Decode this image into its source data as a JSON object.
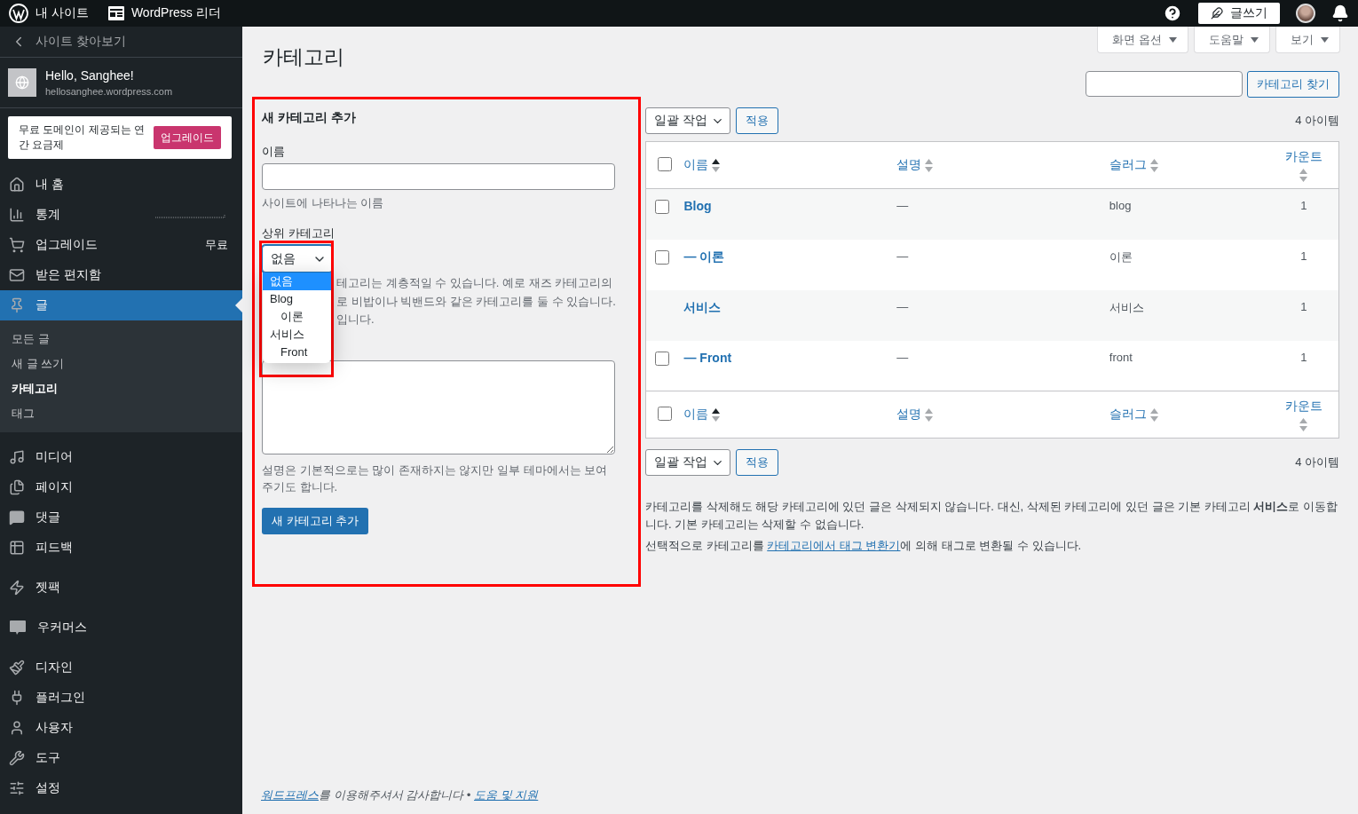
{
  "topbar": {
    "site_label": "내 사이트",
    "reader_label": "WordPress 리더",
    "write_button": "글쓰기"
  },
  "sidebar": {
    "back_link": "사이트 찾아보기",
    "site": {
      "title": "Hello, Sanghee!",
      "url": "hellosanghee.wordpress.com"
    },
    "promo": {
      "text": "무료 도메인이 제공되는 연간 요금제",
      "button": "업그레이드"
    },
    "groups": [
      {
        "items": [
          {
            "kind": "link",
            "label": "내 홈",
            "selected": false
          },
          {
            "kind": "stats",
            "label": "통계",
            "selected": false
          },
          {
            "kind": "link",
            "label": "업그레이드",
            "badge": "무료",
            "selected": false
          },
          {
            "kind": "link",
            "label": "받은 편지함",
            "selected": false
          },
          {
            "kind": "link",
            "label": "글",
            "selected": true,
            "children": [
              {
                "label": "모든 글",
                "selected": false
              },
              {
                "label": "새 글 쓰기",
                "selected": false
              },
              {
                "label": "카테고리",
                "selected": true
              },
              {
                "label": "태그",
                "selected": false
              }
            ]
          }
        ]
      },
      {
        "items": [
          {
            "kind": "link",
            "label": "미디어",
            "selected": false
          },
          {
            "kind": "link",
            "label": "페이지",
            "selected": false
          },
          {
            "kind": "link",
            "label": "댓글",
            "selected": false
          },
          {
            "kind": "link",
            "label": "피드백",
            "selected": false
          }
        ]
      },
      {
        "items": [
          {
            "kind": "link",
            "label": "젯팩",
            "selected": false
          }
        ]
      },
      {
        "items": [
          {
            "kind": "link",
            "label": "우커머스",
            "selected": false
          }
        ]
      },
      {
        "items": [
          {
            "kind": "link",
            "label": "디자인",
            "selected": false
          },
          {
            "kind": "link",
            "label": "플러그인",
            "selected": false
          },
          {
            "kind": "link",
            "label": "사용자",
            "selected": false
          },
          {
            "kind": "link",
            "label": "도구",
            "selected": false
          },
          {
            "kind": "link",
            "label": "설정",
            "selected": false
          }
        ]
      }
    ]
  },
  "page": {
    "title": "카테고리",
    "screen_buttons": [
      "화면 옵션",
      "도움말",
      "보기"
    ],
    "search_button": "카테고리 찾기"
  },
  "form": {
    "highlighted": true,
    "heading": "새 카테고리 추가",
    "name_label": "이름",
    "name_hint": "사이트에 나타나는 이름",
    "parent_label": "상위 카테고리",
    "parent_select": {
      "value": "없음",
      "highlighted": true,
      "expanded": true,
      "options": [
        {
          "label": "없음",
          "selected": true
        },
        {
          "label": "Blog",
          "selected": false,
          "children": [
            {
              "label": "이론",
              "selected": false
            }
          ]
        },
        {
          "label": "서비스",
          "selected": false,
          "children": [
            {
              "label": "Front",
              "selected": false
            }
          ]
        }
      ]
    },
    "parent_hint_lines": [
      "테고리는 계층적일 수 있습니다. 예로 재즈 카테고리의",
      "로 비밥이나 빅밴드와 같은 카테고리를 둘 수 있습니다.",
      "입니다."
    ],
    "description_hint": "설명은 기본적으로는 많이 존재하지는 않지만 일부 테마에서는 보여주기도 합니다.",
    "submit": "새 카테고리 추가"
  },
  "table": {
    "bulk_action": "일괄 작업",
    "apply": "적용",
    "count": "4 아이템",
    "all_checked": false,
    "footer_all_checked": false,
    "columns": [
      {
        "label": "이름",
        "sorted": true
      },
      {
        "label": "설명",
        "sorted": false
      },
      {
        "label": "슬러그",
        "sorted": false
      },
      {
        "label": "카운트",
        "sorted": false
      }
    ],
    "rows": [
      {
        "kind": "category",
        "checked": false,
        "name": "Blog",
        "description": "—",
        "slug": "blog",
        "count": "1"
      },
      {
        "kind": "category",
        "checked": false,
        "name": "— 이론",
        "description": "—",
        "slug": "이론",
        "count": "1"
      },
      {
        "kind": "default",
        "name": "서비스",
        "description": "—",
        "slug": "서비스",
        "count": "1"
      },
      {
        "kind": "category",
        "checked": false,
        "name": "— Front",
        "description": "—",
        "slug": "front",
        "count": "1"
      }
    ],
    "footer_columns": [
      {
        "label": "이름",
        "sorted": true
      },
      {
        "label": "설명",
        "sorted": false
      },
      {
        "label": "슬러그",
        "sorted": false
      },
      {
        "label": "카운트",
        "sorted": false
      }
    ],
    "bottom_bulk_action": "일괄 작업",
    "bottom_apply": "적용",
    "bottom_count": "4 아이템"
  },
  "notes": {
    "delete_note": "카테고리를 삭제해도 해당 카테고리에 있던 글은 삭제되지 않습니다. 대신, 삭제된 카테고리에 있던 글은 기본 카테고리 **서비스**로 이동합니다. 기본 카테고리는 삭제할 수 없습니다.",
    "convert_before": "선택적으로 카테고리를 ",
    "convert_link": "카테고리에서 태그 변환기",
    "convert_after": "에 의해 태그로 변환될 수 있습니다."
  },
  "footer": {
    "link": "워드프레스",
    "text": "를 이용해주셔서 감사합니다",
    "separator": "•",
    "help_link": "도움 및 지원"
  }
}
